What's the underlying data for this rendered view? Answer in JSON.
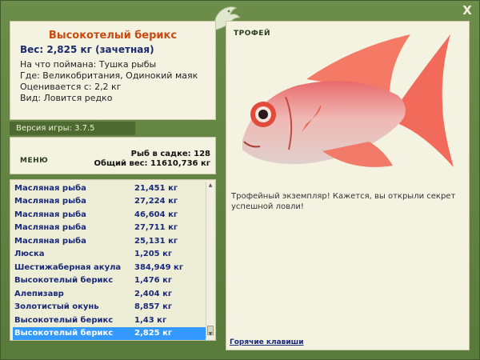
{
  "window": {
    "close_label": "X"
  },
  "fish_info": {
    "name": "Высокотелый берикс",
    "weight": "Вес: 2,825 кг (зачетная)",
    "bait": "На что поймана: Тушка рыбы",
    "location": "Где: Великобритания, Одинокий маяк",
    "value": "Оценивается с: 2,2 кг",
    "rarity": "Вид: Ловится редко"
  },
  "version": "Версия игры: 3.7.5",
  "menu_label": "МЕНЮ",
  "stats": {
    "fish_in_cage": "Рыб в садке: 128",
    "total_weight": "Общий вес: 11610,736 кг"
  },
  "catch_list": [
    {
      "name": "Масляная рыба",
      "weight": "21,451 кг"
    },
    {
      "name": "Масляная рыба",
      "weight": "27,224 кг"
    },
    {
      "name": "Масляная рыба",
      "weight": "46,604 кг"
    },
    {
      "name": "Масляная рыба",
      "weight": "27,711 кг"
    },
    {
      "name": "Масляная рыба",
      "weight": "25,131 кг"
    },
    {
      "name": "Люска",
      "weight": "1,205 кг"
    },
    {
      "name": "Шестижаберная акула",
      "weight": "384,949 кг"
    },
    {
      "name": "Высокотелый берикс",
      "weight": "1,476 кг"
    },
    {
      "name": "Алепизавр",
      "weight": "2,404 кг"
    },
    {
      "name": "Золотистый окунь",
      "weight": "8,857 кг"
    },
    {
      "name": "Высокотелый берикс",
      "weight": "1,43 кг"
    },
    {
      "name": "Высокотелый берикс",
      "weight": "2,825 кг",
      "selected": true
    }
  ],
  "trophy": {
    "title": "ТРОФЕЙ",
    "message": "Трофейный экземпляр! Кажется, вы открыли секрет успешной ловли!",
    "hotkeys_label": "Горячие клавиши"
  },
  "colors": {
    "frame_green": "#5f7f40",
    "panel_bg": "#f4f3e2",
    "selection": "#3399ff",
    "fish_name": "#c84a10",
    "list_text": "#1a2a7a"
  },
  "icons": {
    "logo": "fish-logo-icon",
    "close": "close-icon",
    "fish": "fish-image"
  }
}
